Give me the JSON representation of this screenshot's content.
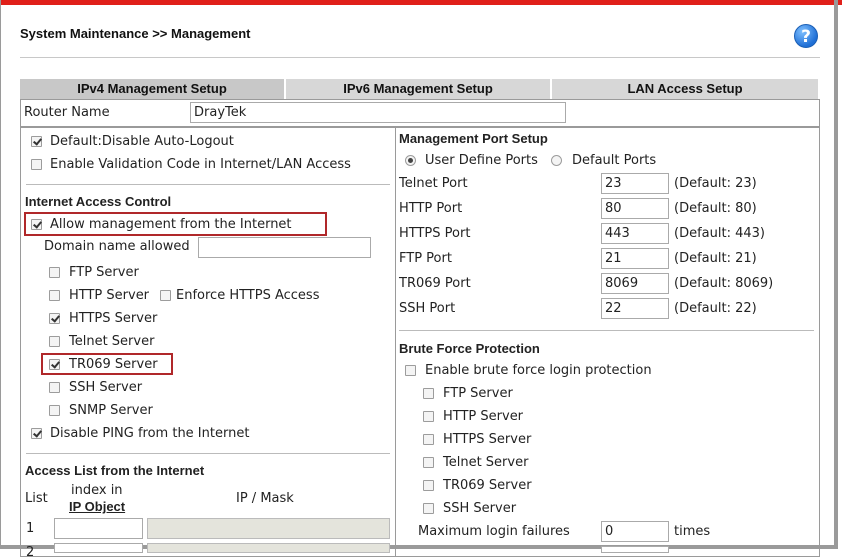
{
  "header": {
    "title": "System Maintenance >> Management",
    "help_icon": "?"
  },
  "tabs": [
    "IPv4 Management Setup",
    "IPv6 Management Setup",
    "LAN Access Setup"
  ],
  "router_name": {
    "label": "Router Name",
    "value": "DrayTek"
  },
  "left": {
    "default_auto_logout": "Default:Disable Auto-Logout",
    "validation_code": "Enable Validation Code in Internet/LAN Access",
    "internet_access_title": "Internet Access Control",
    "allow_mgmt": "Allow management from the Internet",
    "domain_label": "Domain name allowed",
    "domain_value": "",
    "servers": {
      "ftp": "FTP Server",
      "http": "HTTP Server",
      "enforce_https": "Enforce HTTPS Access",
      "https": "HTTPS Server",
      "telnet": "Telnet Server",
      "tr069": "TR069 Server",
      "ssh": "SSH Server",
      "snmp": "SNMP Server"
    },
    "disable_ping": "Disable PING from the Internet",
    "access_list_title": "Access List from the Internet",
    "col_list": "List",
    "col_index": "index in",
    "col_ipobject": "IP Object",
    "col_ipmask": "IP / Mask",
    "row1": "1",
    "row2": "2"
  },
  "right": {
    "port_setup_title": "Management Port Setup",
    "user_define": "User Define Ports",
    "default_ports": "Default Ports",
    "ports": {
      "telnet": {
        "label": "Telnet Port",
        "value": "23",
        "def": "(Default: 23)"
      },
      "http": {
        "label": "HTTP Port",
        "value": "80",
        "def": "(Default: 80)"
      },
      "https": {
        "label": "HTTPS Port",
        "value": "443",
        "def": "(Default: 443)"
      },
      "ftp": {
        "label": "FTP Port",
        "value": "21",
        "def": "(Default: 21)"
      },
      "tr069": {
        "label": "TR069 Port",
        "value": "8069",
        "def": "(Default: 8069)"
      },
      "ssh": {
        "label": "SSH Port",
        "value": "22",
        "def": "(Default: 22)"
      }
    },
    "brute_title": "Brute Force Protection",
    "enable_brute": "Enable brute force login protection",
    "bf": {
      "ftp": "FTP Server",
      "http": "HTTP Server",
      "https": "HTTPS Server",
      "telnet": "Telnet Server",
      "tr069": "TR069 Server",
      "ssh": "SSH Server"
    },
    "max_fail_label": "Maximum login failures",
    "max_fail_value": "0",
    "max_fail_unit": "times"
  }
}
